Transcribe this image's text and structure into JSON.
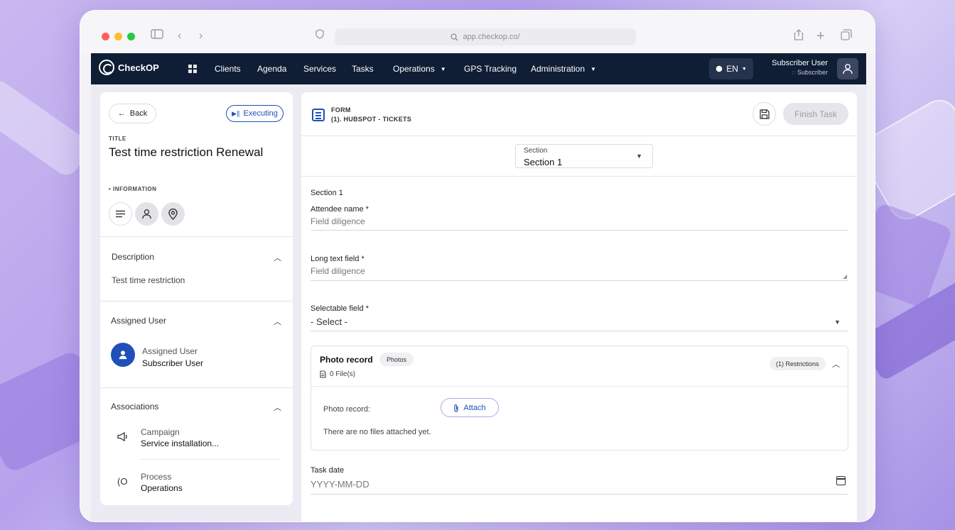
{
  "browser": {
    "url": "app.checkop.co/"
  },
  "nav": {
    "brand": "CheckOP",
    "items": [
      "Clients",
      "Agenda",
      "Services",
      "Tasks",
      "Operations",
      "GPS Tracking",
      "Administration"
    ],
    "language": "EN",
    "user_name": "Subscriber User",
    "user_role": "Subscriber"
  },
  "task": {
    "back_label": "Back",
    "status": "Executing",
    "title_label": "TITLE",
    "title": "Test time restriction Renewal",
    "info_label": "• INFORMATION",
    "description_label": "Description",
    "description_text": "Test time restriction",
    "assigned_section": "Assigned User",
    "assigned_label": "Assigned User",
    "assigned_value": "Subscriber User",
    "associations_section": "Associations",
    "campaign_label": "Campaign",
    "campaign_value": "Service installation...",
    "process_label": "Process",
    "process_value": "Operations"
  },
  "form": {
    "label": "FORM",
    "name": "(1). HUBSPOT - TICKETS",
    "finish_label": "Finish Task",
    "section_small": "Section",
    "section_selected": "Section 1",
    "section_heading": "Section 1",
    "attendee_label": "Attendee name *",
    "attendee_value": "Field diligence",
    "long_text_label": "Long text field *",
    "long_text_value": "Field diligence",
    "selectable_label": "Selectable field *",
    "selectable_value": "- Select -",
    "photo_title": "Photo record",
    "photos_chip": "Photos",
    "restrictions_chip": "(1) Restrictions",
    "files_count": "0 File(s)",
    "photo_field_label": "Photo record:",
    "attach_label": "Attach",
    "no_files": "There are no files attached yet.",
    "task_date_label": "Task date",
    "task_date_placeholder": "YYYY-MM-DD"
  },
  "colors": {
    "navbar": "#0f1d35",
    "accent": "#1f4fb8"
  }
}
